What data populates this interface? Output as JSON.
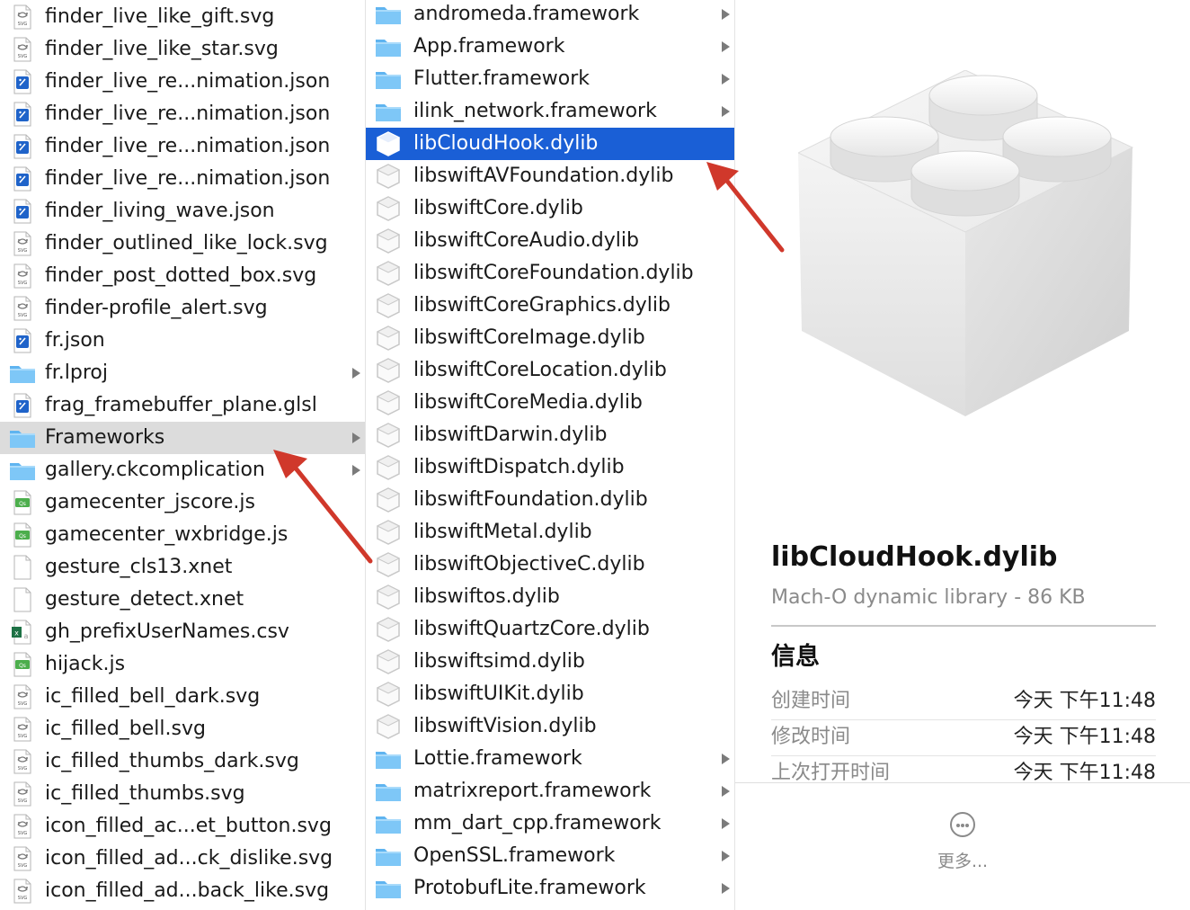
{
  "left_column": {
    "items": [
      {
        "name": "finder_live_like_gift.svg",
        "icon": "svg-file-icon",
        "folder": false
      },
      {
        "name": "finder_live_like_star.svg",
        "icon": "svg-file-icon",
        "folder": false
      },
      {
        "name": "finder_live_re...nimation.json",
        "icon": "json-file-icon",
        "folder": false
      },
      {
        "name": "finder_live_re...nimation.json",
        "icon": "json-file-icon",
        "folder": false
      },
      {
        "name": "finder_live_re...nimation.json",
        "icon": "json-file-icon",
        "folder": false
      },
      {
        "name": "finder_live_re...nimation.json",
        "icon": "json-file-icon",
        "folder": false
      },
      {
        "name": "finder_living_wave.json",
        "icon": "json-file-icon",
        "folder": false
      },
      {
        "name": "finder_outlined_like_lock.svg",
        "icon": "svg-file-icon",
        "folder": false
      },
      {
        "name": "finder_post_dotted_box.svg",
        "icon": "svg-file-icon",
        "folder": false
      },
      {
        "name": "finder-profile_alert.svg",
        "icon": "svg-file-icon",
        "folder": false
      },
      {
        "name": "fr.json",
        "icon": "json-file-icon",
        "folder": false
      },
      {
        "name": "fr.lproj",
        "icon": "folder-icon",
        "folder": true
      },
      {
        "name": "frag_framebuffer_plane.glsl",
        "icon": "json-file-icon",
        "folder": false
      },
      {
        "name": "Frameworks",
        "icon": "folder-icon",
        "folder": true,
        "highlighted": true
      },
      {
        "name": "gallery.ckcomplication",
        "icon": "folder-icon",
        "folder": true
      },
      {
        "name": "gamecenter_jscore.js",
        "icon": "js-file-icon",
        "folder": false
      },
      {
        "name": "gamecenter_wxbridge.js",
        "icon": "js-file-icon",
        "folder": false
      },
      {
        "name": "gesture_cls13.xnet",
        "icon": "blank-file-icon",
        "folder": false
      },
      {
        "name": "gesture_detect.xnet",
        "icon": "blank-file-icon",
        "folder": false
      },
      {
        "name": "gh_prefixUserNames.csv",
        "icon": "csv-file-icon",
        "folder": false
      },
      {
        "name": "hijack.js",
        "icon": "js-file-icon",
        "folder": false
      },
      {
        "name": "ic_filled_bell_dark.svg",
        "icon": "svg-file-icon",
        "folder": false
      },
      {
        "name": "ic_filled_bell.svg",
        "icon": "svg-file-icon",
        "folder": false
      },
      {
        "name": "ic_filled_thumbs_dark.svg",
        "icon": "svg-file-icon",
        "folder": false
      },
      {
        "name": "ic_filled_thumbs.svg",
        "icon": "svg-file-icon",
        "folder": false
      },
      {
        "name": "icon_filled_ac...et_button.svg",
        "icon": "svg-file-icon",
        "folder": false
      },
      {
        "name": "icon_filled_ad...ck_dislike.svg",
        "icon": "svg-file-icon",
        "folder": false
      },
      {
        "name": "icon_filled_ad...back_like.svg",
        "icon": "svg-file-icon",
        "folder": false
      }
    ]
  },
  "middle_column": {
    "items": [
      {
        "name": "andromeda.framework",
        "icon": "folder-icon",
        "folder": true
      },
      {
        "name": "App.framework",
        "icon": "folder-icon",
        "folder": true
      },
      {
        "name": "Flutter.framework",
        "icon": "folder-icon",
        "folder": true
      },
      {
        "name": "ilink_network.framework",
        "icon": "folder-icon",
        "folder": true
      },
      {
        "name": "libCloudHook.dylib",
        "icon": "dylib-icon",
        "folder": false,
        "selected": true
      },
      {
        "name": "libswiftAVFoundation.dylib",
        "icon": "dylib-icon",
        "folder": false
      },
      {
        "name": "libswiftCore.dylib",
        "icon": "dylib-icon",
        "folder": false
      },
      {
        "name": "libswiftCoreAudio.dylib",
        "icon": "dylib-icon",
        "folder": false
      },
      {
        "name": "libswiftCoreFoundation.dylib",
        "icon": "dylib-icon",
        "folder": false
      },
      {
        "name": "libswiftCoreGraphics.dylib",
        "icon": "dylib-icon",
        "folder": false
      },
      {
        "name": "libswiftCoreImage.dylib",
        "icon": "dylib-icon",
        "folder": false
      },
      {
        "name": "libswiftCoreLocation.dylib",
        "icon": "dylib-icon",
        "folder": false
      },
      {
        "name": "libswiftCoreMedia.dylib",
        "icon": "dylib-icon",
        "folder": false
      },
      {
        "name": "libswiftDarwin.dylib",
        "icon": "dylib-icon",
        "folder": false
      },
      {
        "name": "libswiftDispatch.dylib",
        "icon": "dylib-icon",
        "folder": false
      },
      {
        "name": "libswiftFoundation.dylib",
        "icon": "dylib-icon",
        "folder": false
      },
      {
        "name": "libswiftMetal.dylib",
        "icon": "dylib-icon",
        "folder": false
      },
      {
        "name": "libswiftObjectiveC.dylib",
        "icon": "dylib-icon",
        "folder": false
      },
      {
        "name": "libswiftos.dylib",
        "icon": "dylib-icon",
        "folder": false
      },
      {
        "name": "libswiftQuartzCore.dylib",
        "icon": "dylib-icon",
        "folder": false
      },
      {
        "name": "libswiftsimd.dylib",
        "icon": "dylib-icon",
        "folder": false
      },
      {
        "name": "libswiftUIKit.dylib",
        "icon": "dylib-icon",
        "folder": false
      },
      {
        "name": "libswiftVision.dylib",
        "icon": "dylib-icon",
        "folder": false
      },
      {
        "name": "Lottie.framework",
        "icon": "folder-icon",
        "folder": true
      },
      {
        "name": "matrixreport.framework",
        "icon": "folder-icon",
        "folder": true
      },
      {
        "name": "mm_dart_cpp.framework",
        "icon": "folder-icon",
        "folder": true
      },
      {
        "name": "OpenSSL.framework",
        "icon": "folder-icon",
        "folder": true
      },
      {
        "name": "ProtobufLite.framework",
        "icon": "folder-icon",
        "folder": true
      }
    ]
  },
  "preview": {
    "icon": "lego-brick-library-icon",
    "name": "libCloudHook.dylib",
    "kind": "Mach-O dynamic library",
    "separator": "-",
    "size": "86 KB",
    "info_heading": "信息",
    "info_rows": [
      {
        "label": "创建时间",
        "value": "今天 下午11:48"
      },
      {
        "label": "修改时间",
        "value": "今天 下午11:48"
      },
      {
        "label": "上次打开时间",
        "value": "今天 下午11:48"
      }
    ],
    "more_icon": "ellipsis-circle-icon",
    "more_label": "更多..."
  },
  "annotations": {
    "arrow_color": "#d0382b"
  },
  "colors": {
    "selection": "#1a5fd6",
    "highlight": "#dcdcdc",
    "folder": "#5fb4f0",
    "chevron": "#7b7b7b"
  }
}
